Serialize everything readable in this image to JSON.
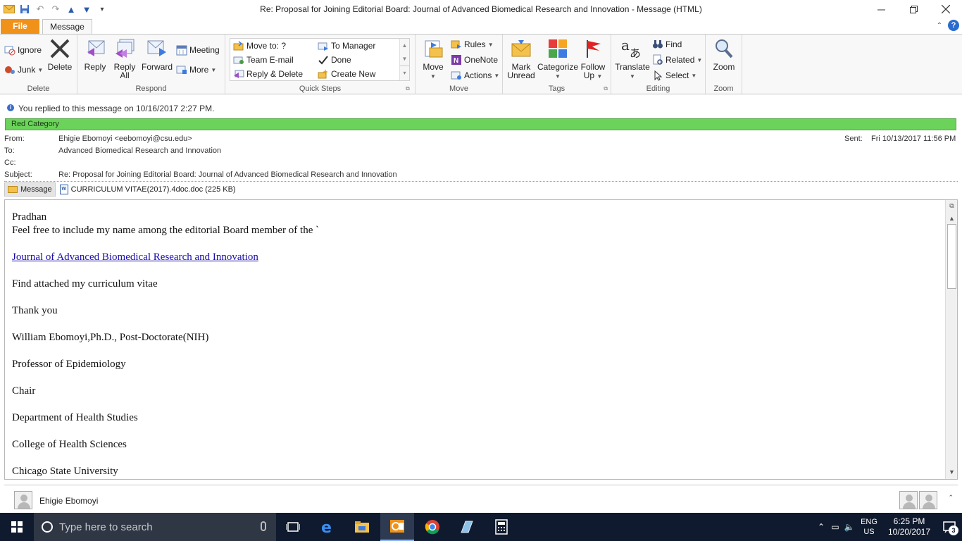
{
  "window": {
    "title": "Re: Proposal for Joining Editorial Board: Journal of Advanced Biomedical Research and Innovation  -  Message (HTML)"
  },
  "tabs": {
    "file": "File",
    "message": "Message"
  },
  "ribbon": {
    "delete_group": {
      "label": "Delete",
      "ignore": "Ignore",
      "junk": "Junk",
      "delete": "Delete"
    },
    "respond_group": {
      "label": "Respond",
      "reply": "Reply",
      "reply_all_1": "Reply",
      "reply_all_2": "All",
      "forward": "Forward",
      "meeting": "Meeting",
      "more": "More"
    },
    "quicksteps_group": {
      "label": "Quick Steps",
      "items": [
        "Move to: ?",
        "To Manager",
        "Team E-mail",
        "Done",
        "Reply & Delete",
        "Create New"
      ]
    },
    "move_group": {
      "label": "Move",
      "move": "Move",
      "rules": "Rules",
      "onenote": "OneNote",
      "actions": "Actions"
    },
    "tags_group": {
      "label": "Tags",
      "mark_unread_1": "Mark",
      "mark_unread_2": "Unread",
      "categorize": "Categorize",
      "follow_up_1": "Follow",
      "follow_up_2": "Up"
    },
    "editing_group": {
      "label": "Editing",
      "translate": "Translate",
      "find": "Find",
      "related": "Related",
      "select": "Select"
    },
    "zoom_group": {
      "label": "Zoom",
      "zoom": "Zoom"
    }
  },
  "info_bar": {
    "text": "You replied to this message on 10/16/2017 2:27 PM."
  },
  "category": {
    "text": "Red Category",
    "color": "#6bd35a"
  },
  "header": {
    "from_label": "From:",
    "from": "Ehigie Ebomoyi <eebomoyi@csu.edu>",
    "to_label": "To:",
    "to": "Advanced Biomedical Research and Innovation",
    "cc_label": "Cc:",
    "cc": "",
    "subject_label": "Subject:",
    "subject": "Re: Proposal for Joining Editorial Board: Journal of Advanced Biomedical Research and Innovation",
    "sent_label": "Sent:",
    "sent": "Fri 10/13/2017 11:56 PM"
  },
  "attachments": {
    "message_tab": "Message",
    "file": "CURRICULUM VITAE(2017).4doc.doc (225 KB)"
  },
  "body": {
    "greeting": "Pradhan",
    "line1": "Feel free to include my name among the editorial Board member of  the `",
    "link": "Journal of Advanced Biomedical Research and Innovation",
    "line2": "Find attached my curriculum vitae",
    "line3": "Thank you",
    "sig1": "William Ebomoyi,Ph.D., Post-Doctorate(NIH)",
    "sig2": "Professor of Epidemiology",
    "sig3": "Chair",
    "sig4": "Department of Health Studies",
    "sig5": "College of Health Sciences",
    "sig6": "Chicago State University"
  },
  "people": {
    "name": "Ehigie Ebomoyi"
  },
  "taskbar": {
    "search_placeholder": "Type here to search",
    "lang1": "ENG",
    "lang2": "US",
    "time": "6:25 PM",
    "date": "10/20/2017",
    "notifications": "3"
  }
}
